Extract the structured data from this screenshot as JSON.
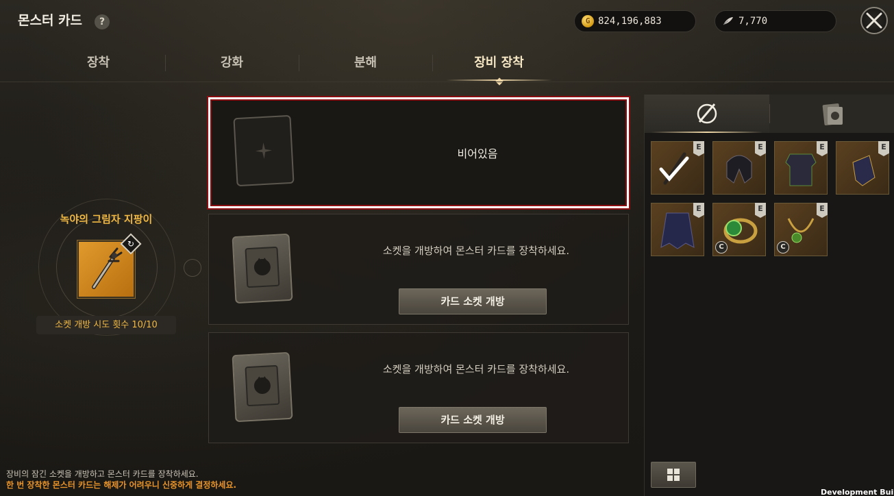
{
  "header": {
    "title": "몬스터 카드",
    "help_label": "?"
  },
  "currency": {
    "gold": "824,196,883",
    "gem": "7,770"
  },
  "tabs": [
    {
      "label": "장착",
      "active": false
    },
    {
      "label": "강화",
      "active": false
    },
    {
      "label": "분해",
      "active": false
    },
    {
      "label": "장비 장착",
      "active": true
    }
  ],
  "equipment": {
    "name": "녹야의 그림자 지팡이",
    "socket_attempts": "소켓 개방 시도 횟수 10/10"
  },
  "sockets": [
    {
      "state": "empty",
      "text": "비어있음"
    },
    {
      "state": "locked",
      "text": "소켓을 개방하여 몬스터 카드를 장착하세요.",
      "button": "카드 소켓 개방"
    },
    {
      "state": "locked",
      "text": "소켓을 개방하여 몬스터 카드를 장착하세요.",
      "button": "카드 소켓 개방"
    }
  ],
  "inventory": {
    "tabs": [
      "equipment-tab",
      "card-tab"
    ],
    "items": [
      {
        "icon": "staff-icon",
        "grade": "E",
        "equipped": true
      },
      {
        "icon": "helmet-icon",
        "grade": "E"
      },
      {
        "icon": "armor-icon",
        "grade": "E"
      },
      {
        "icon": "gauntlet-icon",
        "grade": "E"
      },
      {
        "icon": "cloak-icon",
        "grade": "E"
      },
      {
        "icon": "ring-icon",
        "grade": "E",
        "sub_grade": "C"
      },
      {
        "icon": "necklace-icon",
        "grade": "E",
        "sub_grade": "C"
      }
    ]
  },
  "footer": {
    "line1": "장비의 잠긴 소켓을 개방하고 몬스터 카드를 장착하세요.",
    "line2": "한 번 장착한 몬스터 카드는 해제가 어려우니 신중하게 결정하세요."
  },
  "dev_build": "Development Build",
  "colors": {
    "accent_gold": "#f0b843",
    "warning": "#e8942a",
    "highlight_red": "#8a0d12"
  }
}
